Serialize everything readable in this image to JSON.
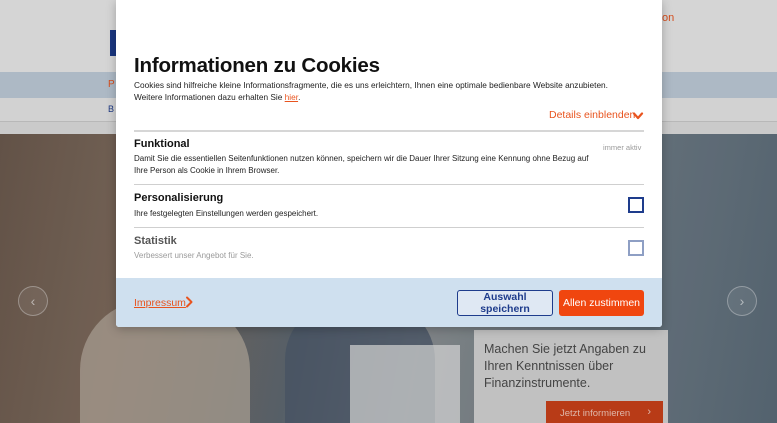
{
  "background": {
    "login_label": "on",
    "nav_item": "P",
    "subnav_item": "B",
    "hero_panel_text": "Machen Sie jetzt Angaben zu Ihren Kenntnissen über Finanzinstrumente.",
    "hero_cta_label": "Jetzt informieren",
    "hero_cta_icon": "chevron-right-icon",
    "slider_prev_icon": "chevron-left-icon",
    "slider_next_icon": "chevron-right-icon"
  },
  "cookie_modal": {
    "title": "Informationen zu Cookies",
    "intro_text": "Cookies sind hilfreiche kleine Informationsfragmente, die es uns erleichtern, Ihnen eine optimale bedienbare Website anzubieten. Weitere Informationen dazu erhalten Sie ",
    "intro_link": "hier",
    "intro_end": ".",
    "details_toggle": "Details einblenden",
    "details_icon": "chevron-down-icon",
    "categories": [
      {
        "title": "Funktional",
        "description": "Damit Sie die essentiellen Seitenfunktionen nutzen können, speichern wir die Dauer Ihrer Sitzung eine Kennung ohne Bezug auf Ihre Person als Cookie in Ihrem Browser.",
        "status": "immer aktiv"
      },
      {
        "title": "Personalisierung",
        "description": "Ihre festgelegten Einstellungen werden gespeichert.",
        "checked": false
      },
      {
        "title": "Statistik",
        "description": "Verbessert unser Angebot für Sie.",
        "checked": false
      }
    ],
    "footer": {
      "impressum_label": "Impressum",
      "impressum_icon": "chevron-right-icon",
      "save_button": "Auswahl speichern",
      "accept_button": "Allen zustimmen"
    }
  },
  "colors": {
    "accent_orange": "#e8541f",
    "brand_blue": "#1e3c8c",
    "footer_bg": "#cfe0ef",
    "accept_bg": "#f0460f"
  }
}
